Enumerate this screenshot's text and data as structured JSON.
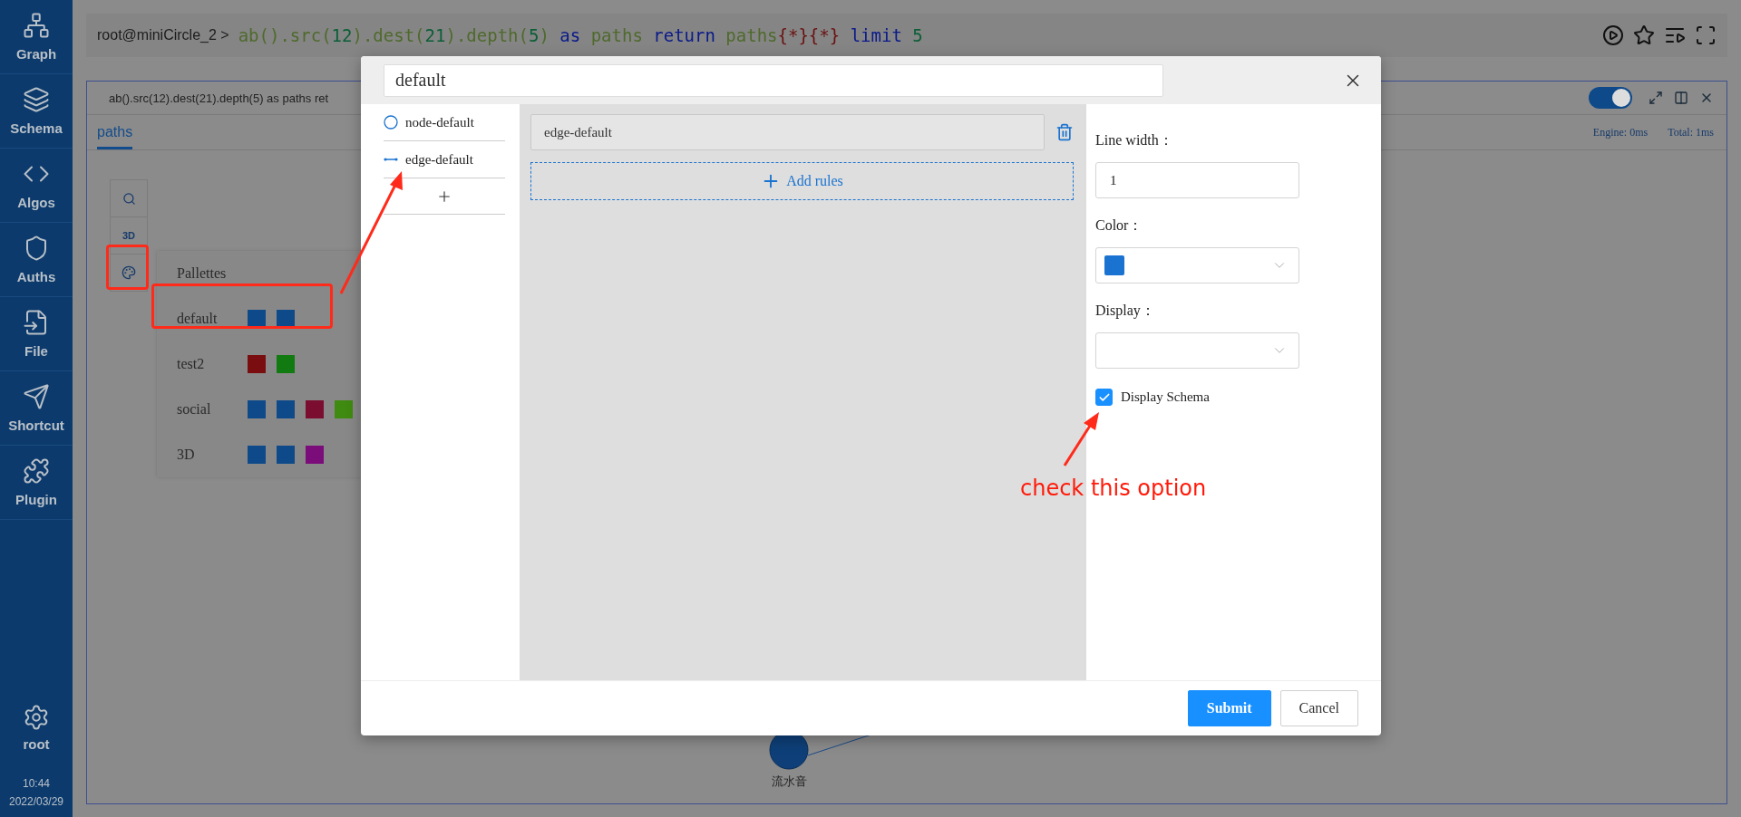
{
  "sidebar": {
    "items": [
      {
        "kind": "graph",
        "label": "Graph"
      },
      {
        "kind": "schema",
        "label": "Schema"
      },
      {
        "kind": "algos",
        "label": "Algos"
      },
      {
        "kind": "auths",
        "label": "Auths"
      },
      {
        "kind": "file",
        "label": "File"
      },
      {
        "kind": "shortcut",
        "label": "Shortcut"
      },
      {
        "kind": "plugin",
        "label": "Plugin"
      }
    ],
    "user": "root",
    "time": "10:44",
    "date": "2022/03/29"
  },
  "query_bar": {
    "prompt": "root@miniCircle_2 >",
    "tokens": [
      {
        "kind": "ident",
        "text": "ab().src("
      },
      {
        "kind": "number",
        "text": "12"
      },
      {
        "kind": "ident",
        "text": ").dest("
      },
      {
        "kind": "number",
        "text": "21"
      },
      {
        "kind": "ident",
        "text": ").depth("
      },
      {
        "kind": "number",
        "text": "5"
      },
      {
        "kind": "ident",
        "text": ")"
      },
      {
        "kind": "keyword",
        "text": "as"
      },
      {
        "kind": "ident",
        "text": "paths"
      },
      {
        "kind": "keyword",
        "text": "return"
      },
      {
        "kind": "ident",
        "text": "paths"
      },
      {
        "kind": "brace",
        "text": "{*}{*}"
      },
      {
        "kind": "keyword",
        "text": "limit"
      },
      {
        "kind": "number",
        "text": "5"
      }
    ]
  },
  "result_panel": {
    "query": "ab().src(12).dest(21).depth(5) as paths ret",
    "layout_toggle": {
      "on": true
    },
    "tabs": [
      {
        "label": "paths",
        "selected": true
      }
    ],
    "engine": "Engine: 0ms",
    "total": "Total: 1ms",
    "tools": {
      "mode_label": "3D"
    },
    "pallettes": {
      "title": "Pallettes",
      "items": [
        {
          "name": "default",
          "swatches": [
            {
              "color": "#0e4a8a"
            },
            {
              "color": "#0e4a8a"
            }
          ]
        },
        {
          "name": "test2",
          "swatches": [
            {
              "color": "#7a0d10"
            },
            {
              "color": "#117a10"
            }
          ]
        },
        {
          "name": "social",
          "swatches": [
            {
              "color": "#0e4a8a"
            },
            {
              "color": "#0e4a8a"
            },
            {
              "color": "#7a0d30"
            },
            {
              "color": "#3f8a10"
            }
          ]
        },
        {
          "name": "3D",
          "swatches": [
            {
              "color": "#0e4a8a"
            },
            {
              "color": "#0e4a8a"
            },
            {
              "color": "#7a0d7a"
            }
          ]
        }
      ]
    },
    "graph_nodes": [
      {
        "label": "流水音"
      }
    ]
  },
  "dialog": {
    "name_value": "default",
    "styles": [
      {
        "kind": "node",
        "label": "node-default"
      },
      {
        "kind": "edge",
        "label": "edge-default"
      }
    ],
    "rules": [
      {
        "label": "edge-default"
      }
    ],
    "add_rules": "Add rules",
    "line_width": {
      "label": "Line width：",
      "value": "1"
    },
    "color": {
      "label": "Color：",
      "swatch": {
        "color": "#1a73d0"
      }
    },
    "display": {
      "label": "Display："
    },
    "display_schema": {
      "label": "Display Schema",
      "checked": true
    },
    "buttons": [
      {
        "kind": "primary",
        "label": "Submit"
      },
      {
        "kind": "default",
        "label": "Cancel"
      }
    ]
  },
  "annotation": {
    "note": "check this option"
  }
}
